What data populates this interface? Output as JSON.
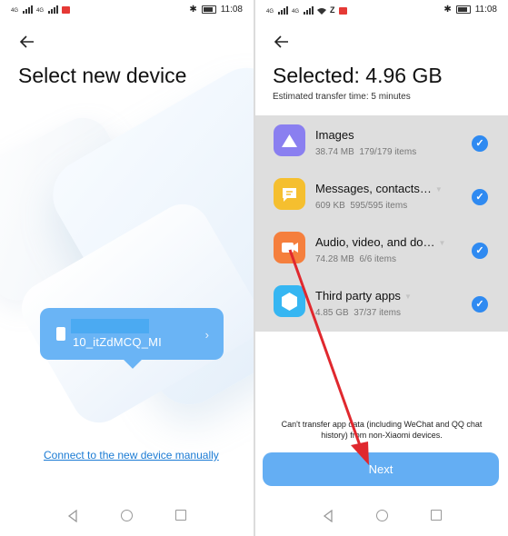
{
  "left_screen": {
    "status_time": "11:08",
    "title": "Select new device",
    "device": {
      "name": "10_itZdMCQ_MI"
    },
    "manual_link": "Connect to the new device manually"
  },
  "right_screen": {
    "status_time": "11:08",
    "title": "Selected: 4.96 GB",
    "subtitle": "Estimated transfer time: 5 minutes",
    "items": [
      {
        "label": "Images",
        "size": "38.74 MB",
        "count": "179/179 items",
        "icon": "mountain-icon",
        "color": "#8a7ff0",
        "checked": true
      },
      {
        "label": "Messages, contacts…",
        "size": "609 KB",
        "count": "595/595 items",
        "icon": "message-icon",
        "color": "#f5bf2f",
        "checked": true
      },
      {
        "label": "Audio, video, and do…",
        "size": "74.28 MB",
        "count": "6/6 items",
        "icon": "video-icon",
        "color": "#f57f3d",
        "checked": true
      },
      {
        "label": "Third party apps",
        "size": "4.85 GB",
        "count": "37/37 items",
        "icon": "hexagon-icon",
        "color": "#36b6f2",
        "checked": true
      }
    ],
    "notice": "Can't transfer app data (including WeChat and QQ chat history) from non-Xiaomi devices.",
    "next_label": "Next"
  },
  "colors": {
    "accent": "#2f8af1",
    "button": "#64aef3",
    "bubble": "#6ab4f5",
    "annotation_arrow": "#e0282e"
  }
}
